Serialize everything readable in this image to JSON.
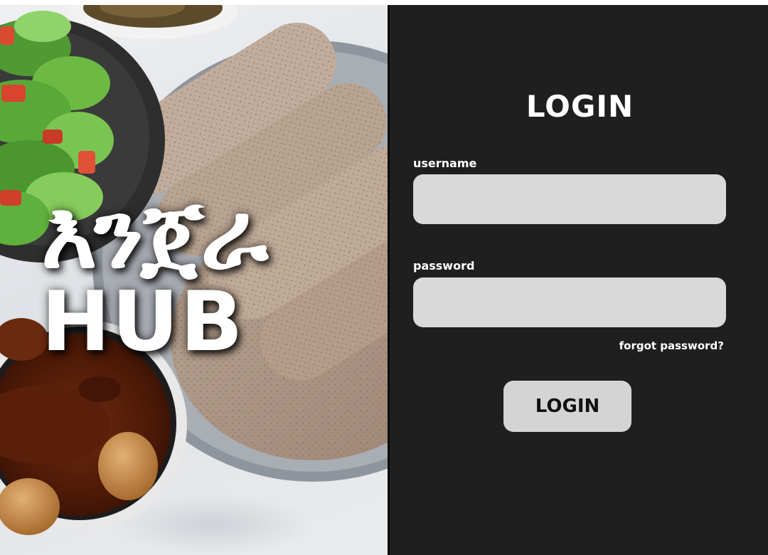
{
  "hero": {
    "title_amharic": "እንጀራ",
    "title_latin": "HUB"
  },
  "login": {
    "title": "LOGIN",
    "username_label": "username",
    "username_value": "",
    "password_label": "password",
    "password_value": "",
    "forgot_label": "forgot password?",
    "button_label": "LOGIN"
  },
  "colors": {
    "panel_bg": "#1f1f1f",
    "field_bg": "#d9d9d9",
    "button_bg": "#d4d4d4",
    "text_light": "#ffffff"
  }
}
